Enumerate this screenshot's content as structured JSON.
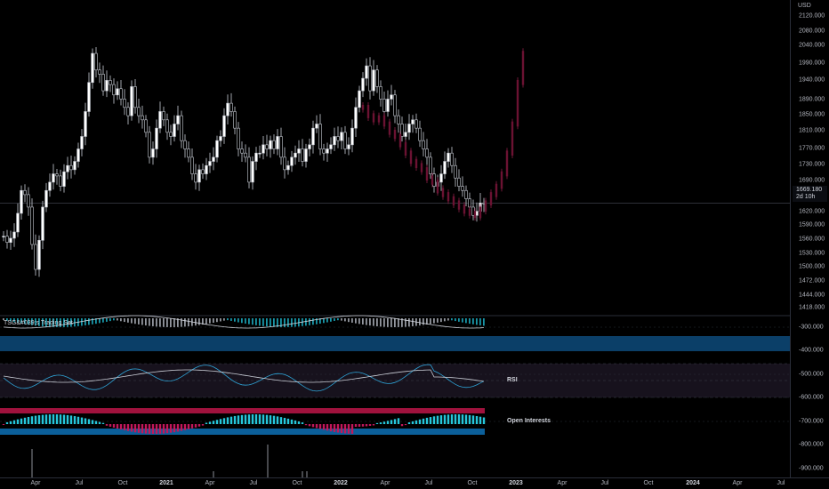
{
  "price_scale": {
    "currency": "USD",
    "ticks": [
      {
        "label": "2120.000",
        "value": 2120
      },
      {
        "label": "2080.000",
        "value": 2080
      },
      {
        "label": "2040.000",
        "value": 2040
      },
      {
        "label": "1990.000",
        "value": 1990
      },
      {
        "label": "1940.000",
        "value": 1940
      },
      {
        "label": "1890.000",
        "value": 1890
      },
      {
        "label": "1850.000",
        "value": 1850
      },
      {
        "label": "1810.000",
        "value": 1810
      },
      {
        "label": "1770.000",
        "value": 1770
      },
      {
        "label": "1730.000",
        "value": 1730
      },
      {
        "label": "1690.000",
        "value": 1690
      },
      {
        "label": "1620.000",
        "value": 1620
      },
      {
        "label": "1590.000",
        "value": 1590
      },
      {
        "label": "1560.000",
        "value": 1560
      },
      {
        "label": "1530.000",
        "value": 1530
      },
      {
        "label": "1500.000",
        "value": 1500
      },
      {
        "label": "1472.000",
        "value": 1472
      },
      {
        "label": "1444.000",
        "value": 1444
      },
      {
        "label": "1418.000",
        "value": 1418
      }
    ],
    "last_price": "1669.180",
    "countdown": "2d 10h"
  },
  "indicator_scale": {
    "ticks": [
      "-300.000",
      "-400.000",
      "-500.000",
      "-600.000",
      "-700.000",
      "-800.000",
      "-900.000"
    ]
  },
  "time_axis": {
    "ticks": [
      {
        "label": "Apr",
        "bold": false
      },
      {
        "label": "Jul",
        "bold": false
      },
      {
        "label": "Oct",
        "bold": false
      },
      {
        "label": "2021",
        "bold": true
      },
      {
        "label": "Apr",
        "bold": false
      },
      {
        "label": "Jul",
        "bold": false
      },
      {
        "label": "Oct",
        "bold": false
      },
      {
        "label": "2022",
        "bold": true
      },
      {
        "label": "Apr",
        "bold": false
      },
      {
        "label": "Jul",
        "bold": false
      },
      {
        "label": "Oct",
        "bold": false
      },
      {
        "label": "2023",
        "bold": true
      },
      {
        "label": "Apr",
        "bold": false
      },
      {
        "label": "Jul",
        "bold": false
      },
      {
        "label": "Oct",
        "bold": false
      },
      {
        "label": "2024",
        "bold": true
      },
      {
        "label": "Apr",
        "bold": false
      },
      {
        "label": "Jul",
        "bold": false
      }
    ]
  },
  "panes": {
    "tsg_label": "TSG&#039;s Trading Set",
    "rsi_label": "RSI",
    "oi_label": "Open Interests"
  },
  "chart_data": {
    "type": "candlestick",
    "period": "weekly",
    "currency": "USD",
    "ylim": [
      1400,
      2140
    ],
    "last_price": 1669.18,
    "series": [
      {
        "name": "",
        "color": "#ffffff",
        "closes": [
          1590,
          1575,
          1585,
          1600,
          1645,
          1700,
          1690,
          1660,
          1570,
          1510,
          1580,
          1660,
          1700,
          1720,
          1740,
          1735,
          1710,
          1745,
          1760,
          1750,
          1770,
          1800,
          1830,
          1890,
          1960,
          2030,
          1990,
          1980,
          1940,
          1965,
          1955,
          1930,
          1945,
          1920,
          1900,
          1880,
          1950,
          1900,
          1880,
          1870,
          1840,
          1780,
          1800,
          1850,
          1890,
          1870,
          1840,
          1830,
          1860,
          1880,
          1820,
          1800,
          1780,
          1740,
          1720,
          1750,
          1740,
          1760,
          1770,
          1780,
          1820,
          1830,
          1880,
          1910,
          1890,
          1850,
          1800,
          1790,
          1780,
          1720,
          1770,
          1790,
          1790,
          1810,
          1800,
          1820,
          1800,
          1830,
          1780,
          1750,
          1760,
          1780,
          1790,
          1800,
          1770,
          1800,
          1810,
          1850,
          1860,
          1800,
          1790,
          1800,
          1810,
          1830,
          1820,
          1840,
          1800,
          1810,
          1850,
          1900,
          1940,
          1970,
          2000,
          1940,
          1990,
          1950,
          1920,
          1890,
          1920,
          1930,
          1880,
          1860,
          1830,
          1840,
          1860,
          1870,
          1850,
          1820,
          1800,
          1780,
          1740,
          1710,
          1720,
          1740,
          1770,
          1790,
          1760,
          1730,
          1710,
          1700,
          1680,
          1660,
          1640,
          1650,
          1670,
          1669
        ]
      },
      {
        "name": "",
        "color": "#c2185b",
        "closes": [
          1900,
          1880,
          1870,
          1875,
          1860,
          1840,
          1830,
          1810,
          1790,
          1770,
          1760,
          1750,
          1730,
          1720,
          1700,
          1690,
          1680,
          1670,
          1660,
          1650,
          1645,
          1640,
          1655,
          1670,
          1690,
          1710,
          1740,
          1790,
          1860,
          1960,
          2030
        ]
      }
    ],
    "indicators": [
      {
        "name": "TSG&#039;s Trading Set",
        "ylim": [
          -400,
          -280
        ]
      },
      {
        "name": "RSI",
        "ylim": [
          -600,
          -450
        ]
      },
      {
        "name": "Open Interests",
        "ylim": [
          -760,
          -620
        ]
      }
    ]
  }
}
